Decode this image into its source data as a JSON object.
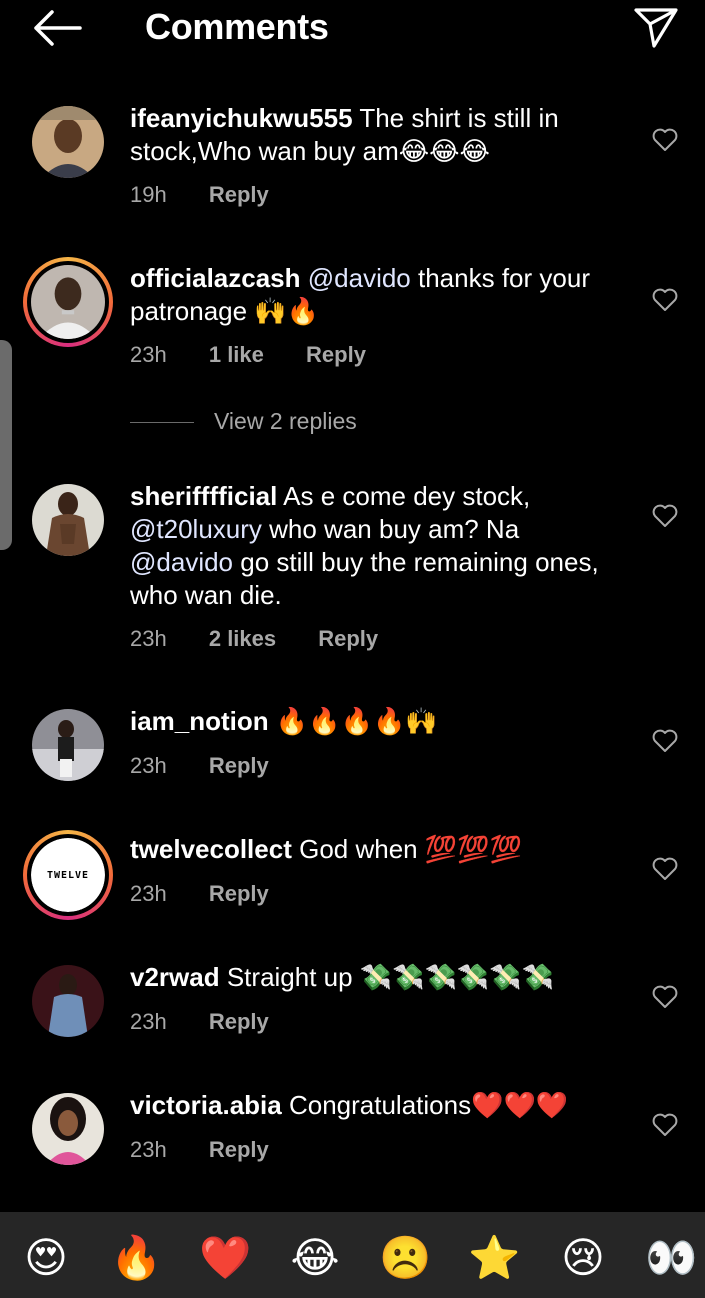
{
  "header": {
    "title": "Comments",
    "back_icon": "arrow-left-icon",
    "send_icon": "paper-plane-icon"
  },
  "comments": [
    {
      "user": "ifeanyichukwu555",
      "text": "The shirt is still in stock,Who wan buy am😂😂😂",
      "time": "19h",
      "likes": "",
      "reply": "Reply",
      "story_ring": false
    },
    {
      "user": "officialazcash",
      "mention": "@davido",
      "text": "thanks for your patronage 🙌🔥",
      "time": "23h",
      "likes": "1 like",
      "reply": "Reply",
      "story_ring": true
    },
    {
      "user": "sherifffficial",
      "text_a": "As e come dey stock,",
      "mention_a": "@t20luxury",
      "text_b": "who wan buy am? Na",
      "mention_b": "@davido",
      "text_c": "go still buy the remaining ones, who wan die.",
      "time": "23h",
      "likes": "2 likes",
      "reply": "Reply",
      "story_ring": false
    },
    {
      "user": "iam_notion",
      "text": "🔥🔥🔥🔥🙌",
      "time": "23h",
      "likes": "",
      "reply": "Reply",
      "story_ring": false
    },
    {
      "user": "twelvecollect",
      "text": "God when 💯💯💯",
      "time": "23h",
      "likes": "",
      "reply": "Reply",
      "story_ring": true,
      "logo_text": "TWELVE"
    },
    {
      "user": "v2rwad",
      "text": "Straight up 💸💸💸💸💸💸",
      "time": "23h",
      "likes": "",
      "reply": "Reply",
      "story_ring": false
    },
    {
      "user": "victoria.abia",
      "text": "Congratulations❤️❤️❤️",
      "time": "23h",
      "likes": "",
      "reply": "Reply",
      "story_ring": false
    }
  ],
  "view_replies": "View 2 replies",
  "emoji_bar": [
    "😍",
    "🔥",
    "❤️",
    "😂",
    "☹️",
    "⭐",
    "😢",
    "👀"
  ],
  "colors": {
    "background": "#000000",
    "meta": "#a8a8a8",
    "emoji_bar": "#262626"
  }
}
